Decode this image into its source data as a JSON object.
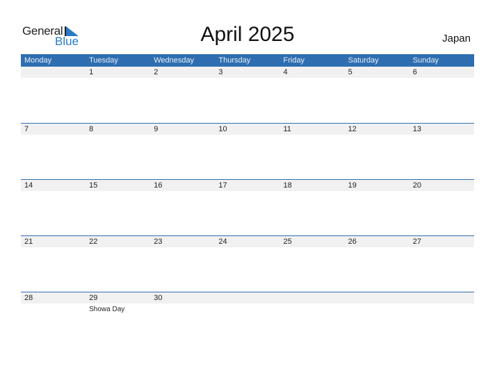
{
  "logo": {
    "line1": "General",
    "line2": "Blue"
  },
  "title": "April 2025",
  "country": "Japan",
  "colors": {
    "header": "#2e6eb0",
    "accent": "#2a7bc4",
    "band": "#f1f1f1"
  },
  "weekdays": [
    "Monday",
    "Tuesday",
    "Wednesday",
    "Thursday",
    "Friday",
    "Saturday",
    "Sunday"
  ],
  "weeks": [
    [
      {
        "day": ""
      },
      {
        "day": "1"
      },
      {
        "day": "2"
      },
      {
        "day": "3"
      },
      {
        "day": "4"
      },
      {
        "day": "5"
      },
      {
        "day": "6"
      }
    ],
    [
      {
        "day": "7"
      },
      {
        "day": "8"
      },
      {
        "day": "9"
      },
      {
        "day": "10"
      },
      {
        "day": "11"
      },
      {
        "day": "12"
      },
      {
        "day": "13"
      }
    ],
    [
      {
        "day": "14"
      },
      {
        "day": "15"
      },
      {
        "day": "16"
      },
      {
        "day": "17"
      },
      {
        "day": "18"
      },
      {
        "day": "19"
      },
      {
        "day": "20"
      }
    ],
    [
      {
        "day": "21"
      },
      {
        "day": "22"
      },
      {
        "day": "23"
      },
      {
        "day": "24"
      },
      {
        "day": "25"
      },
      {
        "day": "26"
      },
      {
        "day": "27"
      }
    ],
    [
      {
        "day": "28"
      },
      {
        "day": "29",
        "holiday": "Showa Day"
      },
      {
        "day": "30"
      },
      {
        "day": ""
      },
      {
        "day": ""
      },
      {
        "day": ""
      },
      {
        "day": ""
      }
    ]
  ]
}
